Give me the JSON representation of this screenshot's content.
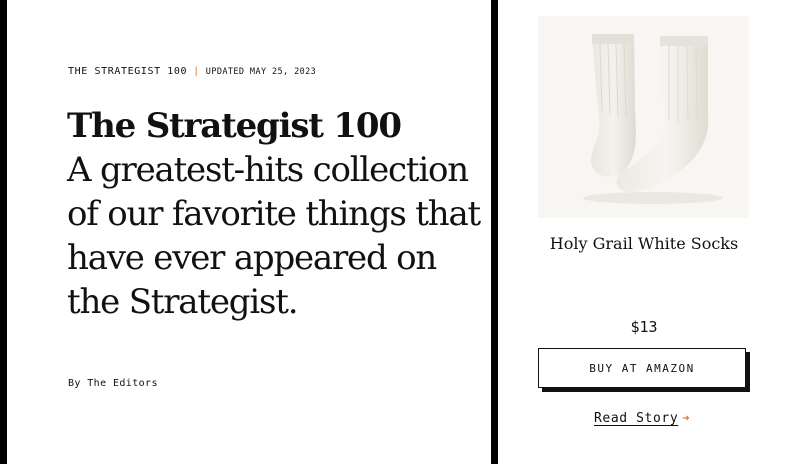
{
  "article": {
    "kicker": "THE STRATEGIST 100",
    "separator": "|",
    "updated": "UPDATED MAY 25, 2023",
    "title": "The Strategist 100",
    "subtitle": "A greatest-hits collection of our favorite things that have ever appeared on the Strategist.",
    "byline": "By The Editors"
  },
  "product": {
    "image_icon": "white-crew-socks-photo",
    "name": "Holy Grail White Socks",
    "price": "$13",
    "buy_label": "BUY AT AMAZON",
    "read_story_label": "Read Story",
    "arrow_icon": "right-arrow-icon"
  },
  "colors": {
    "accent": "#e8702a",
    "rule": "#000000",
    "text": "#111111"
  }
}
